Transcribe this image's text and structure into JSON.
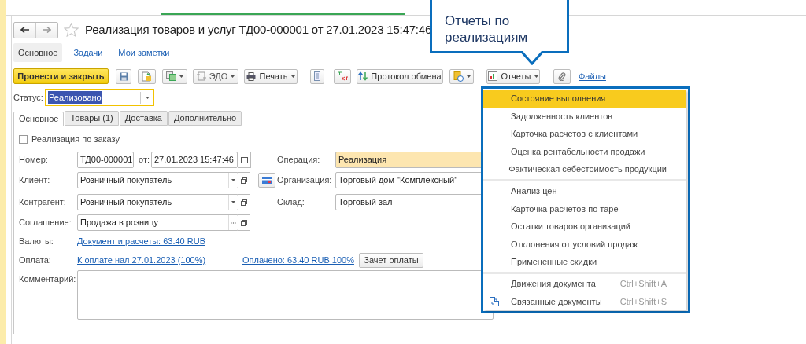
{
  "window": {
    "title": "Реализация товаров и услуг ТД00-000001 от 27.01.2023 15:47:46",
    "favorite": false
  },
  "section_tabs": [
    {
      "label": "Основное",
      "selected": true
    },
    {
      "label": "Задачи",
      "selected": false
    },
    {
      "label": "Мои заметки",
      "selected": false
    }
  ],
  "toolbar": {
    "post_button": "Провести и закрыть",
    "edo_button": "ЭДО",
    "print_button": "Печать",
    "exchange_button": "Протокол обмена",
    "reports_button": "Отчеты",
    "files_link": "Файлы"
  },
  "status": {
    "label": "Статус:",
    "value": "Реализовано"
  },
  "form_tabs": [
    {
      "label": "Основное",
      "selected": true
    },
    {
      "label": "Товары (1)",
      "selected": false
    },
    {
      "label": "Доставка",
      "selected": false
    },
    {
      "label": "Дополнительно",
      "selected": false
    }
  ],
  "by_order": {
    "label": "Реализация по заказу",
    "checked": false
  },
  "number": {
    "label": "Номер:",
    "value": "ТД00-000001",
    "date_label": "от:",
    "date_value": "27.01.2023 15:47:46"
  },
  "operation": {
    "label": "Операция:",
    "value": "Реализация"
  },
  "client": {
    "label": "Клиент:",
    "value": "Розничный покупатель"
  },
  "organization": {
    "label": "Организация:",
    "value": "Торговый дом \"Комплексный\""
  },
  "counterparty": {
    "label": "Контрагент:",
    "value": "Розничный покупатель"
  },
  "warehouse": {
    "label": "Склад:",
    "value": "Торговый зал"
  },
  "agreement": {
    "label": "Соглашение:",
    "value": "Продажа в розницу"
  },
  "currencies": {
    "label": "Валюты:",
    "link": "Документ и расчеты: 63.40 RUB"
  },
  "payment": {
    "label": "Оплата:",
    "due_link": "К оплате нал 27.01.2023 (100%)",
    "paid_link": "Оплачено: 63.40 RUB 100%",
    "offset_button": "Зачет оплаты"
  },
  "comment": {
    "label": "Комментарий:"
  },
  "reports_menu": {
    "groups": [
      [
        {
          "label": "Состояние выполнения",
          "selected": true
        },
        {
          "label": "Задолженность клиентов",
          "selected": false
        },
        {
          "label": "Карточка расчетов с клиентами",
          "selected": false
        },
        {
          "label": "Оценка рентабельности продажи",
          "selected": false
        },
        {
          "label": "Фактическая себестоимость продукции",
          "selected": false
        }
      ],
      [
        {
          "label": "Анализ цен",
          "selected": false
        },
        {
          "label": "Карточка расчетов по таре",
          "selected": false
        },
        {
          "label": "Остатки товаров организаций",
          "selected": false
        },
        {
          "label": "Отклонения от условий продаж",
          "selected": false
        },
        {
          "label": "Примененные скидки",
          "selected": false
        }
      ],
      [
        {
          "label": "Движения документа",
          "selected": false,
          "shortcut": "Ctrl+Shift+A"
        },
        {
          "label": "Связанные документы",
          "selected": false,
          "shortcut": "Ctrl+Shift+S",
          "has_icon": true
        }
      ]
    ]
  },
  "callout": {
    "text": "Отчеты по реализациям"
  }
}
